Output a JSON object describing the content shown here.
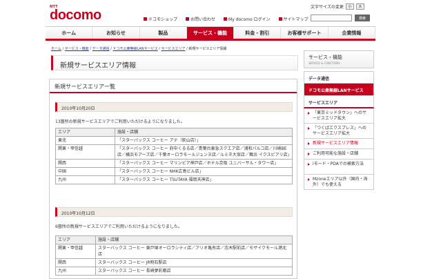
{
  "brand": {
    "ntt": "NTT",
    "name": "docomo"
  },
  "fontsize": {
    "label": "文字サイズの変更",
    "small": "小",
    "large": "大"
  },
  "utility": [
    "ドコモショップ",
    "お問い合わせ",
    "My docomo ログイン",
    "サイトマップ"
  ],
  "search": {
    "button": "検索"
  },
  "gnav": [
    {
      "label": "ホーム"
    },
    {
      "label": "お知らせ"
    },
    {
      "label": "製品"
    },
    {
      "label": "サービス・機能"
    },
    {
      "label": "料金・割引"
    },
    {
      "label": "お客様サポート"
    },
    {
      "label": "企業情報"
    }
  ],
  "breadcrumb": [
    "ホーム",
    "サービス・機能",
    "データ通信",
    "ドコモ公衆無線LANサービス",
    "サービスエリア",
    "新規サービスエリア情報"
  ],
  "page_title": "新規サービスエリア情報",
  "section": {
    "title": "新規サービスエリア一覧",
    "block1": {
      "date": "2010年10月20日",
      "intro": "13箇所の新規サービスエリアでご利用いただけるようになりました。",
      "h1": "エリア",
      "h2": "施設・店舗",
      "rows": [
        [
          "東北",
          "「スターバックス コーヒー アテ（欽山店）」"
        ],
        [
          "関東・甲信越",
          "「スターバックス コーヒー 府中くるる店／青葉台東急スクエア店／浦和パルコ店／川崎BE店／横浜モアーズ店／千葉オーロラモールジュンヌ店／ルミネ大宮店／舞浜 イクスピアリ店」"
        ],
        [
          "関西",
          "「スターバックス コーヒー マリンピア神戸店／ホテル京阪 ユニバーサル・タワー店」"
        ],
        [
          "中国",
          "「スターバックス コーヒー NHK広島ビル店」"
        ],
        [
          "九州",
          "「スターバックス コーヒー TSUTAYA 福岡天神店」"
        ]
      ]
    },
    "block2": {
      "date": "2010年10月12日",
      "intro": "6箇所の新規サービスエリアでご利用いただけるようになりました。",
      "h1": "エリア",
      "h2": "施設・店舗",
      "rows": [
        [
          "関東・甲信越",
          "スターバックス コーヒー 東戸塚オーロラシティ店／アリオ亀有店／志木駅前店／モザイクモール港北店"
        ],
        [
          "関西",
          "スターバックス コーヒー JR明石駅店"
        ],
        [
          "九州",
          "スターバックス コーヒー 長崎夢彩都店"
        ]
      ]
    }
  },
  "sidebar": {
    "title": "サービス・機能",
    "subtitle": "SERVICE & FUNCTIONS",
    "cat1": "データ通信",
    "cat2": "ドコモ公衆無線LANサービス",
    "cat3": "サービスエリア",
    "items": [
      "「東京ミッドタウン」へのサービスエリア拡大",
      "「つくばエクスプレス」へのサービスエリア拡大",
      "新規サービスエリア情報",
      "ご利用可能な施設・店舗",
      "iモード・PDAでの検索方法",
      "Mzoneエリア以外（国内・海外）でも使える"
    ]
  }
}
